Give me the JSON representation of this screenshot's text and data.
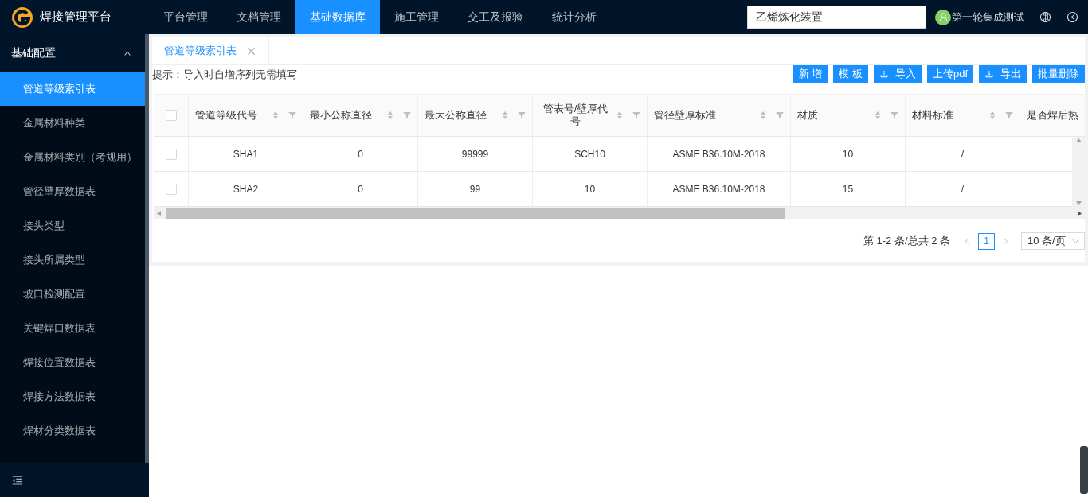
{
  "app": {
    "title": "焊接管理平台"
  },
  "nav": [
    {
      "label": "平台管理",
      "selected": false
    },
    {
      "label": "文档管理",
      "selected": false
    },
    {
      "label": "基础数据库",
      "selected": true
    },
    {
      "label": "施工管理",
      "selected": false
    },
    {
      "label": "交工及报验",
      "selected": false
    },
    {
      "label": "统计分析",
      "selected": false
    }
  ],
  "project_selector": {
    "value": "乙烯炼化装置"
  },
  "user": {
    "name": "第一轮集成测试"
  },
  "sidebar": {
    "group": {
      "label": "基础配置",
      "expanded": true
    },
    "items": [
      {
        "label": "管道等级索引表",
        "selected": true
      },
      {
        "label": "金属材料种类",
        "selected": false
      },
      {
        "label": "金属材料类别（考规用）",
        "selected": false
      },
      {
        "label": "管径壁厚数据表",
        "selected": false
      },
      {
        "label": "接头类型",
        "selected": false
      },
      {
        "label": "接头所属类型",
        "selected": false
      },
      {
        "label": "坡口检测配置",
        "selected": false
      },
      {
        "label": "关键焊口数据表",
        "selected": false
      },
      {
        "label": "焊接位置数据表",
        "selected": false
      },
      {
        "label": "焊接方法数据表",
        "selected": false
      },
      {
        "label": "焊材分类数据表",
        "selected": false
      }
    ]
  },
  "tabs": [
    {
      "label": "管道等级索引表",
      "selected": true
    }
  ],
  "hint": "提示：导入时自增序列无需填写",
  "toolbar": [
    {
      "label": "新 增",
      "kind": "plain"
    },
    {
      "label": "模 板",
      "kind": "plain"
    },
    {
      "label": "导入",
      "kind": "upload"
    },
    {
      "label": "上传pdf",
      "kind": "plain"
    },
    {
      "label": "导出",
      "kind": "download"
    },
    {
      "label": "批量删除",
      "kind": "plain"
    }
  ],
  "table": {
    "all_checked": false,
    "columns": [
      "管道等级代号",
      "最小公称直径",
      "最大公称直径",
      "管表号/壁厚代号",
      "管径壁厚标准",
      "材质",
      "材料标准",
      "是否焊后热"
    ],
    "rows": [
      {
        "checked": false,
        "cells": [
          "SHA1",
          "0",
          "99999",
          "SCH10",
          "ASME B36.10M-2018",
          "10",
          "/"
        ]
      },
      {
        "checked": false,
        "cells": [
          "SHA2",
          "0",
          "99",
          "10",
          "ASME B36.10M-2018",
          "15",
          "/"
        ]
      }
    ]
  },
  "pagination": {
    "summary": "第 1-2 条/总共 2 条",
    "pages": [
      {
        "label": "1",
        "selected": true
      }
    ],
    "page_size": "10 条/页"
  }
}
